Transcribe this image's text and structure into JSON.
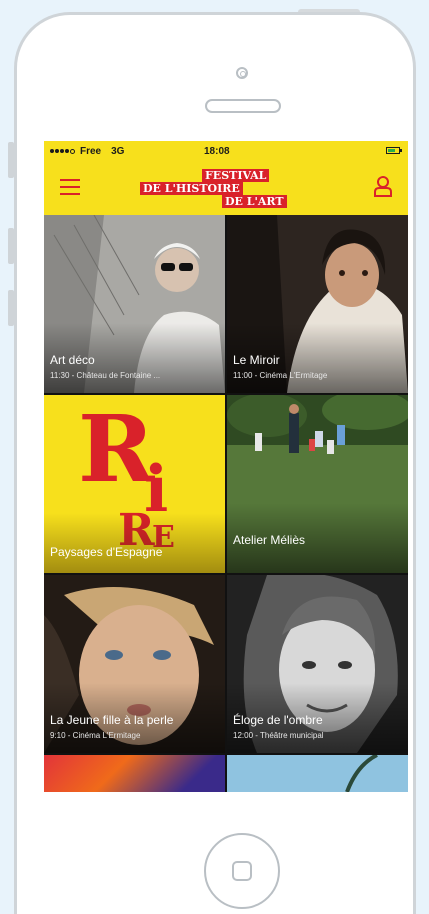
{
  "statusbar": {
    "carrier": "Free",
    "network": "3G",
    "time": "18:08"
  },
  "header": {
    "logo_line1": "FESTIVAL",
    "logo_line2": "DE L'HISTOIRE",
    "logo_line3": "DE L'ART",
    "menu_icon": "hamburger-icon",
    "user_icon": "user-icon"
  },
  "events": [
    {
      "title": "Art déco",
      "subtitle": "11:30 - Château de Fontaine ..."
    },
    {
      "title": "Le Miroir",
      "subtitle": "11:00 - Cinéma L'Ermitage"
    },
    {
      "title": "Paysages d'Espagne",
      "subtitle": ""
    },
    {
      "title": "Atelier Méliès",
      "subtitle": ""
    },
    {
      "title": "La Jeune fille à la perle",
      "subtitle": "9:10 - Cinéma L'Ermitage"
    },
    {
      "title": "Éloge de l'ombre",
      "subtitle": "12:00 - Théâtre municipal"
    }
  ],
  "rire_logo_text": "RIRE",
  "colors": {
    "brand_yellow": "#f7e01c",
    "brand_red": "#d9222a"
  }
}
